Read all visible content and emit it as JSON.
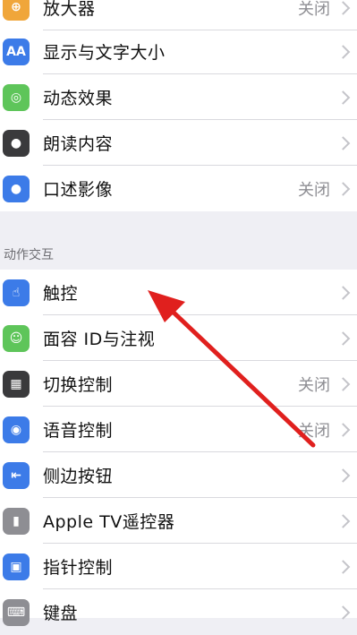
{
  "colors": {
    "background": "#efeff4",
    "row_bg": "#ffffff",
    "value_text": "#8e8e93",
    "annotation_arrow": "#e0201e"
  },
  "sections": {
    "vision": {
      "rows": [
        {
          "label": "放大器",
          "value": "关闭",
          "icon": "magnifier-icon",
          "color": "#f0a63a"
        },
        {
          "label": "显示与文字大小",
          "value": "",
          "icon": "text-size-icon",
          "color": "#3c7be8"
        },
        {
          "label": "动态效果",
          "value": "",
          "icon": "motion-icon",
          "color": "#5ec55a"
        },
        {
          "label": "朗读内容",
          "value": "",
          "icon": "speech-bubble-icon",
          "color": "#3a3a3c"
        },
        {
          "label": "口述影像",
          "value": "关闭",
          "icon": "audio-description-icon",
          "color": "#3c7be8"
        }
      ]
    },
    "interaction": {
      "header": "动作交互",
      "rows": [
        {
          "label": "触控",
          "value": "",
          "icon": "hand-touch-icon",
          "color": "#3c7be8"
        },
        {
          "label": "面容 ID与注视",
          "value": "",
          "icon": "face-id-icon",
          "color": "#5ec55a"
        },
        {
          "label": "切换控制",
          "value": "关闭",
          "icon": "switch-control-icon",
          "color": "#3a3a3c"
        },
        {
          "label": "语音控制",
          "value": "关闭",
          "icon": "voice-control-icon",
          "color": "#3c7be8"
        },
        {
          "label": "侧边按钮",
          "value": "",
          "icon": "side-button-icon",
          "color": "#3c7be8"
        },
        {
          "label": "Apple TV遥控器",
          "value": "",
          "icon": "tv-remote-icon",
          "color": "#8e8e93"
        },
        {
          "label": "指针控制",
          "value": "",
          "icon": "pointer-control-icon",
          "color": "#3c7be8"
        },
        {
          "label": "键盘",
          "value": "",
          "icon": "keyboard-icon",
          "color": "#8e8e93"
        }
      ]
    }
  }
}
